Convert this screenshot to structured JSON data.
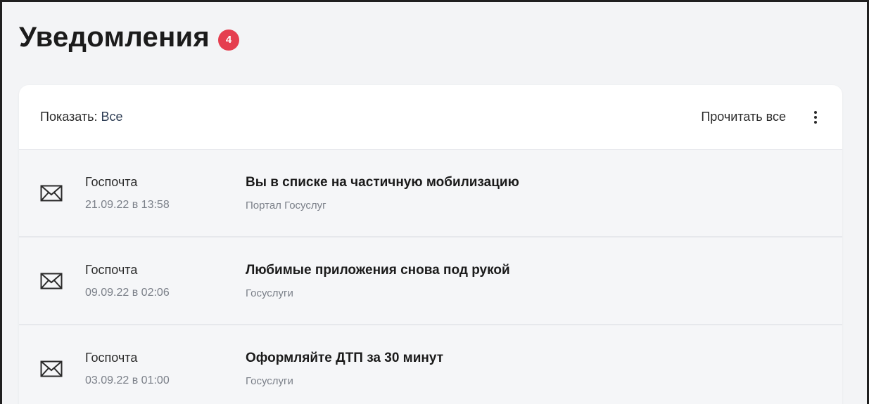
{
  "page": {
    "title": "Уведомления",
    "unread_count": "4"
  },
  "toolbar": {
    "filter_label": "Показать: ",
    "filter_value": "Все",
    "read_all_label": "Прочитать все"
  },
  "colors": {
    "badge": "#e53e4f",
    "row_bg": "#f5f6f8",
    "page_bg": "#f3f4f6"
  },
  "notifications": [
    {
      "icon": "envelope-icon",
      "sender": "Госпочта",
      "date": "21.09.22 в 13:58",
      "subject": "Вы в списке на частичную мобилизацию",
      "source": "Портал Госуслуг"
    },
    {
      "icon": "envelope-icon",
      "sender": "Госпочта",
      "date": "09.09.22 в 02:06",
      "subject": "Любимые приложения снова под рукой",
      "source": "Госуслуги"
    },
    {
      "icon": "envelope-icon",
      "sender": "Госпочта",
      "date": "03.09.22 в 01:00",
      "subject": "Оформляйте ДТП за 30 минут",
      "source": "Госуслуги"
    }
  ]
}
